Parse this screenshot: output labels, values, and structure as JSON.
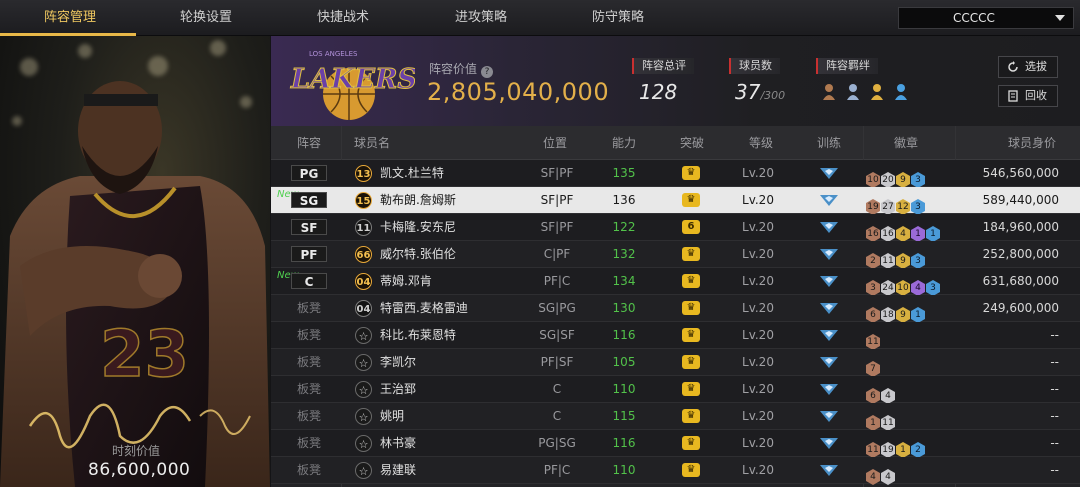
{
  "nav": {
    "tabs": [
      "阵容管理",
      "轮换设置",
      "快捷战术",
      "进攻策略",
      "防守策略"
    ],
    "team_select": "CCCCC"
  },
  "player_card": {
    "label": "时刻价值",
    "value": "86,600,000",
    "jersey_number": "23"
  },
  "team": {
    "logo_text": "LAKERS",
    "logo_subtext": "LOS ANGELES",
    "value_label": "阵容价值",
    "value": "2,805,040,000",
    "rating_label": "阵容总评",
    "rating": "128",
    "count_label": "球员数",
    "count": "37",
    "count_max": "/300",
    "bond_label": "阵容羁绊",
    "buttons": {
      "pick": "选拔",
      "recycle": "回收"
    }
  },
  "table": {
    "headers": [
      "阵容",
      "球员名",
      "位置",
      "能力",
      "突破",
      "等级",
      "训练",
      "徽章",
      "球员身价"
    ],
    "bench_label": "板凳",
    "new_label": "New",
    "rows": [
      {
        "slot": "PG",
        "is_new": false,
        "grade": "13",
        "grade_style": "gold",
        "name": "凯文.杜兰特",
        "pos": "SF|PF",
        "ability": "135",
        "break": "",
        "level": "Lv.20",
        "badges": [
          [
            "10",
            "bronze"
          ],
          [
            "20",
            "silver"
          ],
          [
            "9",
            "gold"
          ],
          [
            "3",
            "blue"
          ]
        ],
        "salary": "546,560,000",
        "selected": false
      },
      {
        "slot": "SG",
        "is_new": true,
        "grade": "15",
        "grade_style": "gold",
        "name": "勒布朗.詹姆斯",
        "pos": "SF|PF",
        "ability": "136",
        "break": "",
        "level": "Lv.20",
        "badges": [
          [
            "19",
            "bronze"
          ],
          [
            "27",
            "silver"
          ],
          [
            "12",
            "gold"
          ],
          [
            "3",
            "blue"
          ]
        ],
        "salary": "589,440,000",
        "selected": true
      },
      {
        "slot": "SF",
        "is_new": false,
        "grade": "11",
        "grade_style": "dark",
        "name": "卡梅隆.安东尼",
        "pos": "SF|PF",
        "ability": "122",
        "break": "6",
        "level": "Lv.20",
        "badges": [
          [
            "16",
            "bronze"
          ],
          [
            "16",
            "silver"
          ],
          [
            "4",
            "gold"
          ],
          [
            "1",
            "purple"
          ],
          [
            "1",
            "blue"
          ]
        ],
        "salary": "184,960,000",
        "selected": false
      },
      {
        "slot": "PF",
        "is_new": false,
        "grade": "66",
        "grade_style": "gold",
        "name": "威尔特.张伯伦",
        "pos": "C|PF",
        "ability": "132",
        "break": "",
        "level": "Lv.20",
        "badges": [
          [
            "2",
            "bronze"
          ],
          [
            "11",
            "silver"
          ],
          [
            "9",
            "gold"
          ],
          [
            "3",
            "blue"
          ]
        ],
        "salary": "252,800,000",
        "selected": false
      },
      {
        "slot": "C",
        "is_new": true,
        "grade": "04",
        "grade_style": "gold",
        "name": "蒂姆.邓肯",
        "pos": "PF|C",
        "ability": "134",
        "break": "",
        "level": "Lv.20",
        "badges": [
          [
            "3",
            "bronze"
          ],
          [
            "24",
            "silver"
          ],
          [
            "10",
            "gold"
          ],
          [
            "4",
            "purple"
          ],
          [
            "3",
            "blue"
          ]
        ],
        "salary": "631,680,000",
        "selected": false
      },
      {
        "slot": "bench",
        "is_new": false,
        "grade": "04",
        "grade_style": "dark",
        "name": "特雷西.麦格雷迪",
        "pos": "SG|PG",
        "ability": "130",
        "break": "",
        "level": "Lv.20",
        "badges": [
          [
            "6",
            "bronze"
          ],
          [
            "18",
            "silver"
          ],
          [
            "9",
            "gold"
          ],
          [
            "1",
            "blue"
          ]
        ],
        "salary": "249,600,000",
        "selected": false
      },
      {
        "slot": "bench",
        "is_new": false,
        "grade": "☆",
        "grade_style": "star",
        "name": "科比.布莱恩特",
        "pos": "SG|SF",
        "ability": "116",
        "break": "",
        "level": "Lv.20",
        "badges": [
          [
            "11",
            "bronze"
          ]
        ],
        "salary": "--",
        "selected": false
      },
      {
        "slot": "bench",
        "is_new": false,
        "grade": "☆",
        "grade_style": "star",
        "name": "李凯尔",
        "pos": "PF|SF",
        "ability": "105",
        "break": "",
        "level": "Lv.20",
        "badges": [
          [
            "7",
            "bronze"
          ]
        ],
        "salary": "--",
        "selected": false
      },
      {
        "slot": "bench",
        "is_new": false,
        "grade": "☆",
        "grade_style": "star",
        "name": "王治郅",
        "pos": "C",
        "ability": "110",
        "break": "",
        "level": "Lv.20",
        "badges": [
          [
            "6",
            "bronze"
          ],
          [
            "4",
            "silver"
          ]
        ],
        "salary": "--",
        "selected": false
      },
      {
        "slot": "bench",
        "is_new": false,
        "grade": "☆",
        "grade_style": "star",
        "name": "姚明",
        "pos": "C",
        "ability": "115",
        "break": "",
        "level": "Lv.20",
        "badges": [
          [
            "1",
            "bronze"
          ],
          [
            "11",
            "silver"
          ]
        ],
        "salary": "--",
        "selected": false
      },
      {
        "slot": "bench",
        "is_new": false,
        "grade": "☆",
        "grade_style": "star",
        "name": "林书豪",
        "pos": "PG|SG",
        "ability": "116",
        "break": "",
        "level": "Lv.20",
        "badges": [
          [
            "11",
            "bronze"
          ],
          [
            "19",
            "silver"
          ],
          [
            "1",
            "gold"
          ],
          [
            "2",
            "blue"
          ]
        ],
        "salary": "--",
        "selected": false
      },
      {
        "slot": "bench",
        "is_new": false,
        "grade": "☆",
        "grade_style": "star",
        "name": "易建联",
        "pos": "PF|C",
        "ability": "110",
        "break": "",
        "level": "Lv.20",
        "badges": [
          [
            "4",
            "bronze"
          ],
          [
            "4",
            "silver"
          ]
        ],
        "salary": "--",
        "selected": false
      }
    ]
  },
  "colors": {
    "accent": "#e8b848",
    "value_gold": "#e3b04a",
    "ability_green": "#52c24a",
    "new_green": "#50d050"
  }
}
